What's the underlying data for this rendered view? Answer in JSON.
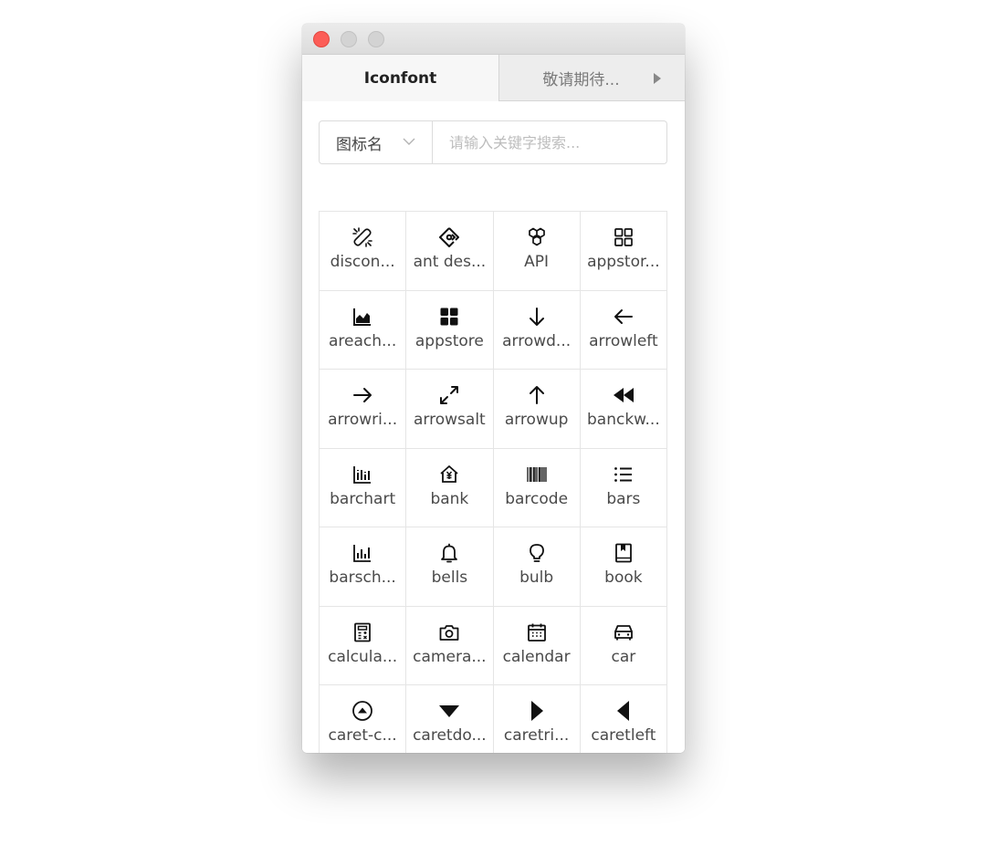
{
  "tabs": [
    {
      "label": "Iconfont",
      "active": true
    },
    {
      "label": "敬请期待...",
      "active": false
    }
  ],
  "search": {
    "select_value": "图标名",
    "placeholder": "请输入关键字搜索..."
  },
  "icons": [
    {
      "label": "discon...",
      "icon": "disconnect-icon"
    },
    {
      "label": "ant des...",
      "icon": "ant-design-icon"
    },
    {
      "label": "API",
      "icon": "api-icon"
    },
    {
      "label": "appstor...",
      "icon": "appstore-outline-icon"
    },
    {
      "label": "areach...",
      "icon": "area-chart-icon"
    },
    {
      "label": "appstore",
      "icon": "appstore-filled-icon"
    },
    {
      "label": "arrowd...",
      "icon": "arrow-down-icon"
    },
    {
      "label": "arrowleft",
      "icon": "arrow-left-icon"
    },
    {
      "label": "arrowri...",
      "icon": "arrow-right-icon"
    },
    {
      "label": "arrowsalt",
      "icon": "arrows-alt-icon"
    },
    {
      "label": "arrowup",
      "icon": "arrow-up-icon"
    },
    {
      "label": "banckw...",
      "icon": "backward-icon"
    },
    {
      "label": "barchart",
      "icon": "bar-chart-icon"
    },
    {
      "label": "bank",
      "icon": "bank-icon"
    },
    {
      "label": "barcode",
      "icon": "barcode-icon"
    },
    {
      "label": "bars",
      "icon": "bars-icon"
    },
    {
      "label": "barsch...",
      "icon": "bars-chart-icon"
    },
    {
      "label": "bells",
      "icon": "bell-icon"
    },
    {
      "label": "bulb",
      "icon": "bulb-icon"
    },
    {
      "label": "book",
      "icon": "book-icon"
    },
    {
      "label": "calcula...",
      "icon": "calculator-icon"
    },
    {
      "label": "camera...",
      "icon": "camera-icon"
    },
    {
      "label": "calendar",
      "icon": "calendar-icon"
    },
    {
      "label": "car",
      "icon": "car-icon"
    },
    {
      "label": "caret-c...",
      "icon": "caret-circle-up-icon"
    },
    {
      "label": "caretdo...",
      "icon": "caret-down-icon"
    },
    {
      "label": "caretri...",
      "icon": "caret-right-icon"
    },
    {
      "label": "caretleft",
      "icon": "caret-left-icon"
    },
    {
      "label": "",
      "icon": ""
    },
    {
      "label": "",
      "icon": ""
    },
    {
      "label": "",
      "icon": ""
    },
    {
      "label": "",
      "icon": ""
    }
  ]
}
